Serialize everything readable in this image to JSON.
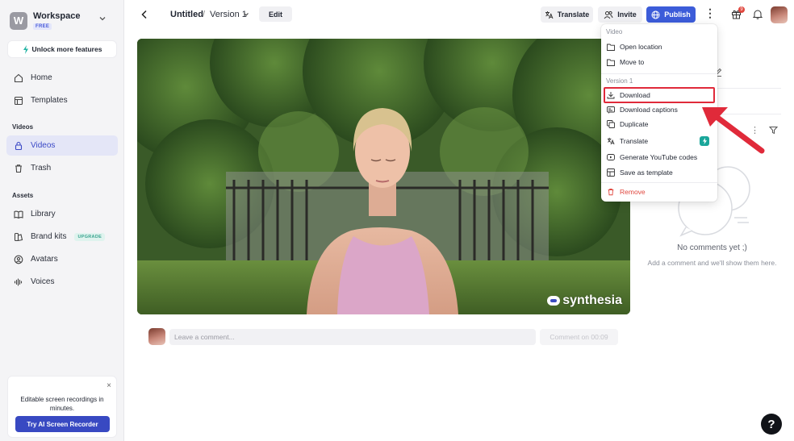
{
  "workspace": {
    "initial": "W",
    "name": "Workspace",
    "plan": "FREE"
  },
  "sidebar": {
    "unlock_label": "Unlock more features",
    "items_top": [
      {
        "label": "Home",
        "icon": "home-icon"
      },
      {
        "label": "Templates",
        "icon": "templates-icon"
      }
    ],
    "videos_section": "Videos",
    "videos_items": [
      {
        "label": "Videos",
        "icon": "lock-icon",
        "active": true
      },
      {
        "label": "Trash",
        "icon": "trash-icon"
      }
    ],
    "assets_section": "Assets",
    "assets_items": [
      {
        "label": "Library",
        "icon": "library-icon"
      },
      {
        "label": "Brand kits",
        "icon": "brand-kit-icon",
        "badge": "UPGRADE"
      },
      {
        "label": "Avatars",
        "icon": "avatar-icon"
      },
      {
        "label": "Voices",
        "icon": "voice-icon"
      }
    ],
    "promo": {
      "text": "Editable screen recordings in minutes.",
      "button": "Try AI Screen Recorder",
      "close": "×"
    }
  },
  "topbar": {
    "title": "Untitled",
    "separator": "/",
    "version": "Version 1",
    "edit": "Edit",
    "translate": "Translate",
    "invite": "Invite",
    "publish": "Publish",
    "more": "⋮",
    "gift_count": "9"
  },
  "video": {
    "watermark": "synthesia"
  },
  "comment": {
    "placeholder": "Leave a comment...",
    "submit": "Comment on 00:09"
  },
  "comments_panel": {
    "empty_title": "No comments yet ;)",
    "empty_sub": "Add a comment and we'll show them here."
  },
  "menu": {
    "header_video": "Video",
    "open_location": "Open location",
    "move_to": "Move to",
    "header_version": "Version 1",
    "download": "Download",
    "download_captions": "Download captions",
    "duplicate": "Duplicate",
    "translate": "Translate",
    "generate_youtube": "Generate YouTube codes",
    "save_template": "Save as template",
    "remove": "Remove"
  },
  "help": "?",
  "colors": {
    "accent": "#3c5cd9",
    "highlight": "#e02a3a",
    "active_nav": "#e4e6f7",
    "teal": "#1aa69a"
  }
}
